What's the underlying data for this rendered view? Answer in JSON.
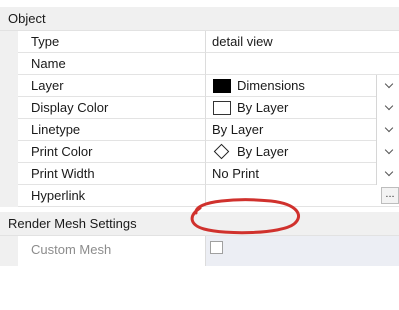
{
  "sections": {
    "object": "Object",
    "render_mesh": "Render Mesh Settings"
  },
  "rows": [
    {
      "label": "Type",
      "value": "detail view"
    },
    {
      "label": "Name",
      "value": ""
    },
    {
      "label": "Layer",
      "value": "Dimensions",
      "icon": "black-color-swatch-icon",
      "icon_color": "#000000"
    },
    {
      "label": "Display Color",
      "value": "By Layer",
      "icon": "white-color-swatch-icon",
      "icon_color": "#ffffff"
    },
    {
      "label": "Linetype",
      "value": "By Layer"
    },
    {
      "label": "Print Color",
      "value": "By Layer",
      "icon": "diamond-icon"
    },
    {
      "label": "Print Width",
      "value": "No Print"
    },
    {
      "label": "Hyperlink",
      "value": "",
      "button": "..."
    }
  ],
  "render_rows": [
    {
      "label": "Custom Mesh"
    }
  ],
  "annotation_color": "#d0312d"
}
